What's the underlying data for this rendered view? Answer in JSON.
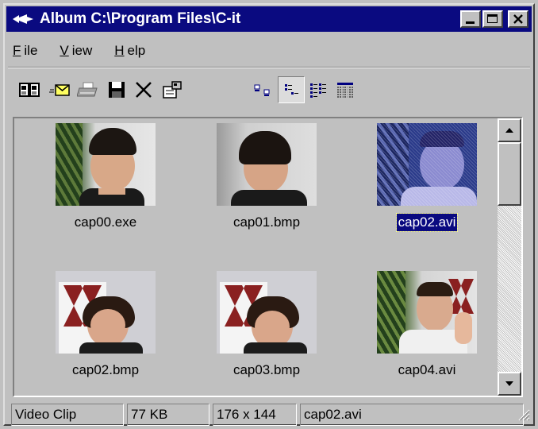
{
  "window": {
    "title": "Album C:\\Program Files\\C-it"
  },
  "menu": [
    {
      "label": "File",
      "key": "F",
      "rest": "ile"
    },
    {
      "label": "View",
      "key": "V",
      "rest": "iew"
    },
    {
      "label": "Help",
      "key": "H",
      "rest": "elp"
    }
  ],
  "toolbar": {
    "actions": [
      "open-album-icon",
      "mail-icon",
      "print-icon",
      "save-icon",
      "delete-icon",
      "properties-icon"
    ],
    "views": [
      "large-icons-view-icon",
      "small-icons-view-icon",
      "list-view-icon",
      "details-view-icon"
    ],
    "active_view": "small-icons-view-icon"
  },
  "items": [
    {
      "label": "cap00.exe",
      "selected": false
    },
    {
      "label": "cap01.bmp",
      "selected": false
    },
    {
      "label": "cap02.avi",
      "selected": true
    },
    {
      "label": "cap02.bmp",
      "selected": false
    },
    {
      "label": "cap03.bmp",
      "selected": false
    },
    {
      "label": "cap04.avi",
      "selected": false
    }
  ],
  "status": {
    "type": "Video Clip",
    "size": "77 KB",
    "dimensions": "176 x 144",
    "filename": "cap02.avi"
  },
  "colors": {
    "titlebar": "#0a0a80",
    "selection": "#0a0a80",
    "face": "#c0c0c0"
  }
}
